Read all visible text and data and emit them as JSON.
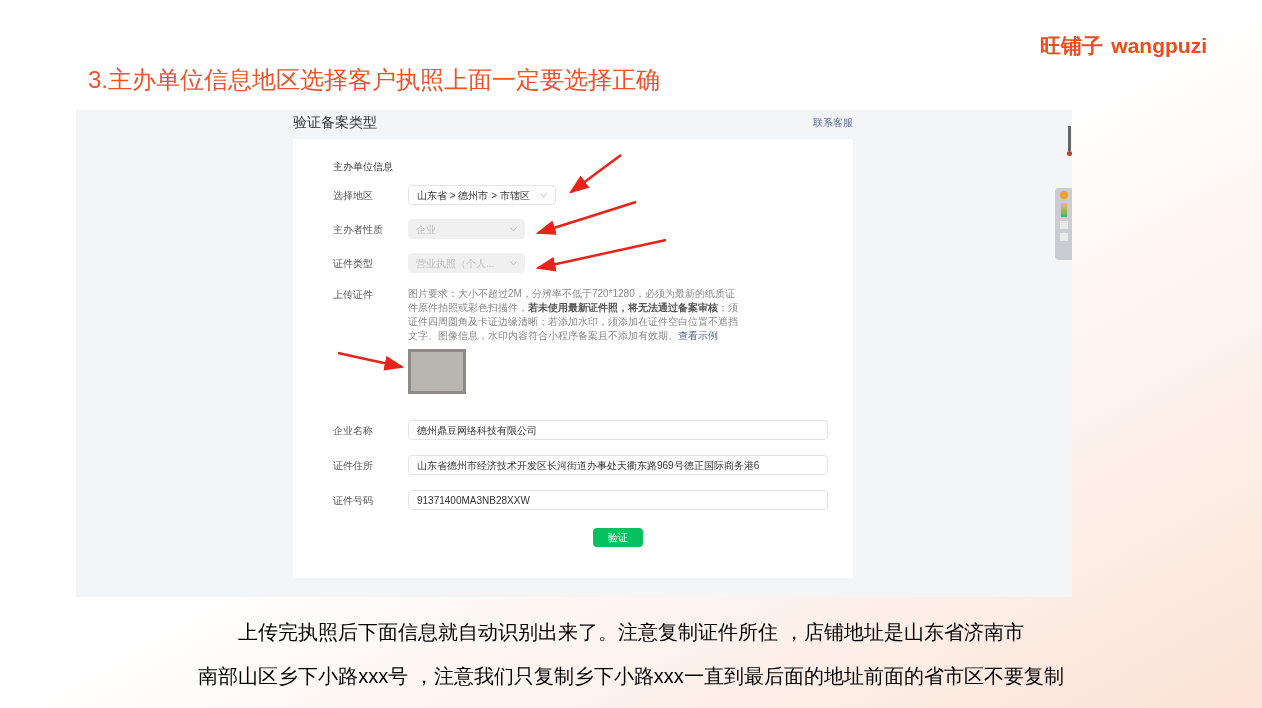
{
  "slide_title": "3.主办单位信息地区选择客户执照上面一定要选择正确",
  "logo": {
    "brand_cn": "旺铺子",
    "brand_en": "wangpuzi"
  },
  "screenshot": {
    "header": "验证备案类型",
    "contact_link": "联系客服",
    "section_title": "主办单位信息",
    "selects": [
      {
        "label": "选择地区",
        "value": "山东省 > 德州市 > 市辖区",
        "disabled": false
      },
      {
        "label": "主办者性质",
        "value": "企业",
        "disabled": true
      },
      {
        "label": "证件类型",
        "value": "营业执照（个人...",
        "disabled": true
      }
    ],
    "upload": {
      "label": "上传证件",
      "help": "图片要求：大小不超过2M，分辨率不低于720*1280，必须为最新的纸质证件原件拍照或彩色扫描件，**若未使用最新证件照，将无法通过备案审核**；须证件四周圆角及卡证边缘清晰；若添加水印，须添加在证件空白位置不遮挡文字、图像信息，水印内容符合小程序备案且不添加有效期。",
      "example_link": "查看示例"
    },
    "inputs": [
      {
        "label": "企业名称",
        "value": "德州鼎豆网络科技有限公司"
      },
      {
        "label": "证件住所",
        "value": "山东省德州市经济技术开发区长河街道办事处天衢东路969号德正国际商务港6"
      },
      {
        "label": "证件号码",
        "value": "91371400MA3NB28XXW"
      }
    ],
    "submit": "验证"
  },
  "captions": [
    "上传完执照后下面信息就自动识别出来了。注意复制证件所住 ，店铺地址是山东省济南市",
    "南部山区乡下小路xxx号 ，注意我们只复制乡下小路xxx一直到最后面的地址前面的省市区不要复制"
  ]
}
